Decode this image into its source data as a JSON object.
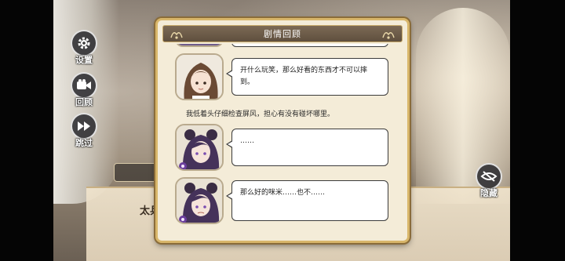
{
  "side_menu": {
    "settings": {
      "label": "设置",
      "icon": "gear-icon"
    },
    "review": {
      "label": "回顾",
      "icon": "camera-icon"
    },
    "skip": {
      "label": "跳过",
      "icon": "fast-forward-icon"
    }
  },
  "hide_button": {
    "label": "隐藏",
    "icon": "eye-hidden-icon"
  },
  "background_dialogue": {
    "speaker": "太兵"
  },
  "review_modal": {
    "title": "剧情回顾",
    "entries": [
      {
        "type": "speech",
        "character": "brown-hair-girl",
        "text": "开什么玩笑，那么好看的东西才不可以摔到。"
      },
      {
        "type": "narration",
        "text": "我低着头仔细检查屏风，担心有没有碰坏哪里。"
      },
      {
        "type": "speech",
        "character": "purple-hair-boy",
        "text": "……"
      },
      {
        "type": "speech",
        "character": "purple-hair-boy",
        "text": "那么好的咪米……也不……"
      }
    ]
  },
  "colors": {
    "frame_gold": "#d8b66a",
    "panel_bg": "#f4ecd8",
    "header_bg": "#6e5d49",
    "avatar_accent": "#6b3f9c"
  }
}
